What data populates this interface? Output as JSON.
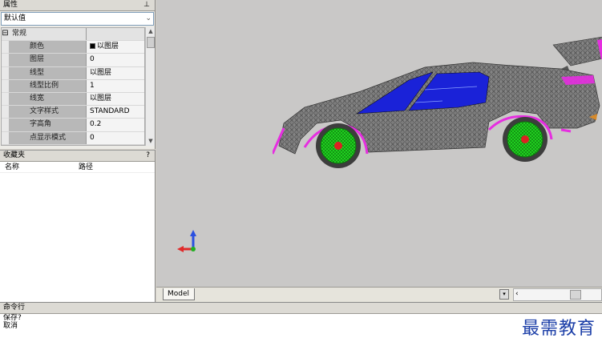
{
  "properties": {
    "title": "属性",
    "pin_icon": "pin-icon",
    "selector": "默认值",
    "group_label": "常规",
    "group_toggle": "⊟",
    "rows": [
      {
        "key": "颜色",
        "value": "以图层",
        "swatch": "#000000"
      },
      {
        "key": "图层",
        "value": "0"
      },
      {
        "key": "线型",
        "value": "以图层"
      },
      {
        "key": "线型比例",
        "value": "1"
      },
      {
        "key": "线宽",
        "value": "以图层"
      },
      {
        "key": "文字样式",
        "value": "STANDARD"
      },
      {
        "key": "字高角",
        "value": "0.2"
      },
      {
        "key": "点显示模式",
        "value": "0"
      }
    ]
  },
  "folder": {
    "title": "收藏夹",
    "help": "?",
    "columns": [
      "名称",
      "路径"
    ]
  },
  "viewport": {
    "tab_label": "Model",
    "colors": {
      "body": "#7a7a7a",
      "glass": "#1a22d8",
      "accent": "#e62ee0",
      "wheel": "#1fd01f",
      "background": "#c9c8c7"
    }
  },
  "command": {
    "title": "命令行",
    "lines": [
      "保存?",
      "取消"
    ]
  },
  "watermark": "最需教育"
}
